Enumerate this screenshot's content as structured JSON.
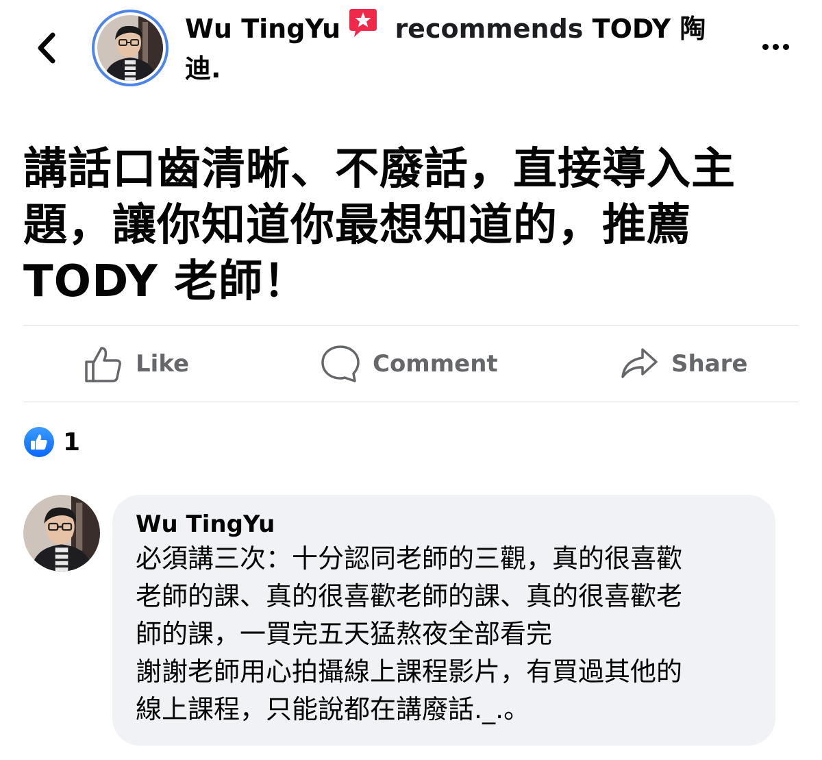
{
  "header": {
    "back_icon": "chevron-left-icon",
    "author_name": "Wu TingYu",
    "badge_icon": "recommend-star-icon",
    "action_text": "recommends",
    "page_name_line1": "TODY 陶",
    "page_name_line2": "迪.",
    "more_icon": "more-horizontal-icon"
  },
  "post": {
    "text_lines": [
      "講話口齒清晰、不廢話，直接導入主",
      "題，讓你知道你最想知道的，推薦",
      "TODY 老師！"
    ]
  },
  "actions": {
    "like_label": "Like",
    "comment_label": "Comment",
    "share_label": "Share"
  },
  "reactions": {
    "icon": "thumbs-up-reaction-icon",
    "count": "1"
  },
  "comment": {
    "author": "Wu TingYu",
    "lines": [
      "必須講三次：十分認同老師的三觀，真的很喜歡",
      "老師的課、真的很喜歡老師的課、真的很喜歡老",
      "師的課，一買完五天猛熬夜全部看完",
      "謝謝老師用心拍攝線上課程影片，有買過其他的",
      "線上課程，只能說都在講廢話._.。"
    ]
  },
  "colors": {
    "avatar_ring": "#4d86e8",
    "badge": "#f02849",
    "like_blue": "#1877f2",
    "action_gray": "#65676b",
    "bubble_bg": "#f0f2f5"
  }
}
